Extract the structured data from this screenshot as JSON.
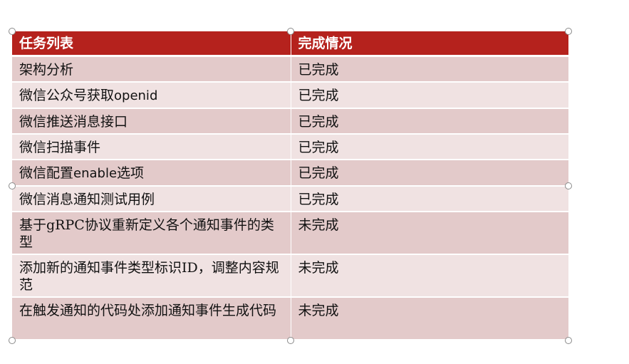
{
  "table": {
    "headers": [
      "任务列表",
      "完成情况"
    ],
    "rows": [
      {
        "task": "架构分析",
        "status": "已完成"
      },
      {
        "task": "微信公众号获取openid",
        "status": "已完成"
      },
      {
        "task": "微信推送消息接口",
        "status": "已完成"
      },
      {
        "task": "微信扫描事件",
        "status": "已完成"
      },
      {
        "task": "微信配置enable选项",
        "status": "已完成"
      },
      {
        "task": "微信消息通知测试用例",
        "status": "已完成"
      },
      {
        "task": "基于gRPC协议重新定义各个通知事件的类型",
        "status": "未完成"
      },
      {
        "task": "添加新的通知事件类型标识ID，调整内容规范",
        "status": "未完成"
      },
      {
        "task": "在触发通知的代码处添加通知事件生成代码",
        "status": "未完成"
      }
    ]
  },
  "colors": {
    "header_bg": "#b5221d",
    "row_odd": "#e3caca",
    "row_even": "#f0e2e2"
  }
}
